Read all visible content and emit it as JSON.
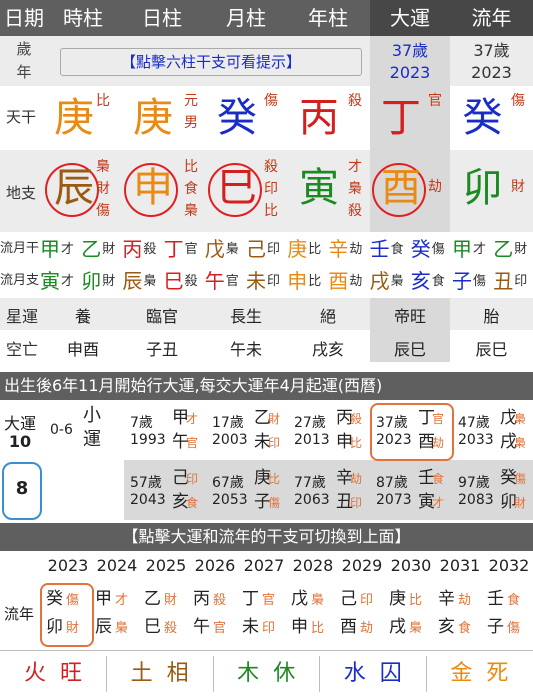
{
  "header": {
    "date": "日期",
    "hour": "時柱",
    "day": "日柱",
    "month": "月柱",
    "year": "年柱",
    "dayun": "大運",
    "liunian": "流年"
  },
  "age_row": {
    "label1": "歲",
    "label2": "年",
    "hint": "【點擊六柱干支可看提示】",
    "dayun_age": "37歲",
    "dayun_year": "2023",
    "ln_age": "37歲",
    "ln_year": "2023"
  },
  "tiangan": {
    "label": "天干",
    "cells": [
      {
        "char": "庚",
        "color": "#e98a12",
        "god": "比",
        "god2": ""
      },
      {
        "char": "庚",
        "color": "#e98a12",
        "god": "元",
        "god2": "男"
      },
      {
        "char": "癸",
        "color": "#1a2cc8",
        "god": "傷",
        "god2": ""
      },
      {
        "char": "丙",
        "color": "#d41f1f",
        "god": "殺",
        "god2": ""
      },
      {
        "char": "丁",
        "color": "#d41f1f",
        "god": "官",
        "god2": ""
      },
      {
        "char": "癸",
        "color": "#1a2cc8",
        "god": "傷",
        "god2": ""
      }
    ]
  },
  "dizhi": {
    "label": "地支",
    "cells": [
      {
        "char": "辰",
        "color": "#9a5a12",
        "gods": [
          "梟",
          "財",
          "傷"
        ]
      },
      {
        "char": "申",
        "color": "#e98a12",
        "gods": [
          "比",
          "食",
          "梟"
        ]
      },
      {
        "char": "巳",
        "color": "#d41f1f",
        "gods": [
          "殺",
          "印",
          "比"
        ]
      },
      {
        "char": "寅",
        "color": "#1c8a22",
        "gods": [
          "才",
          "梟",
          "殺"
        ]
      },
      {
        "char": "酉",
        "color": "#e98a12",
        "gods": [
          "劫"
        ]
      },
      {
        "char": "卯",
        "color": "#1c8a22",
        "gods": [
          "財"
        ]
      }
    ]
  },
  "month_gan": {
    "label": "流月干",
    "items": [
      [
        "甲",
        "才",
        "#1c8a22"
      ],
      [
        "乙",
        "財",
        "#1c8a22"
      ],
      [
        "丙",
        "殺",
        "#d41f1f"
      ],
      [
        "丁",
        "官",
        "#d41f1f"
      ],
      [
        "戊",
        "梟",
        "#9a5a12"
      ],
      [
        "己",
        "印",
        "#9a5a12"
      ],
      [
        "庚",
        "比",
        "#e98a12"
      ],
      [
        "辛",
        "劫",
        "#e98a12"
      ],
      [
        "壬",
        "食",
        "#1a2cc8"
      ],
      [
        "癸",
        "傷",
        "#1a2cc8"
      ],
      [
        "甲",
        "才",
        "#1c8a22"
      ],
      [
        "乙",
        "財",
        "#1c8a22"
      ]
    ]
  },
  "month_zhi": {
    "label": "流月支",
    "items": [
      [
        "寅",
        "才",
        "#1c8a22"
      ],
      [
        "卯",
        "財",
        "#1c8a22"
      ],
      [
        "辰",
        "梟",
        "#9a5a12"
      ],
      [
        "巳",
        "殺",
        "#d41f1f"
      ],
      [
        "午",
        "官",
        "#d41f1f"
      ],
      [
        "未",
        "印",
        "#9a5a12"
      ],
      [
        "申",
        "比",
        "#e98a12"
      ],
      [
        "酉",
        "劫",
        "#e98a12"
      ],
      [
        "戌",
        "梟",
        "#9a5a12"
      ],
      [
        "亥",
        "食",
        "#1a2cc8"
      ],
      [
        "子",
        "傷",
        "#1a2cc8"
      ],
      [
        "丑",
        "印",
        "#9a5a12"
      ]
    ]
  },
  "xingyun": {
    "label": "星運",
    "cells": [
      "養",
      "臨官",
      "長生",
      "絕",
      "帝旺",
      "胎"
    ]
  },
  "kongwang": {
    "label": "空亡",
    "cells": [
      "申酉",
      "子丑",
      "午未",
      "戌亥",
      "辰巳",
      "辰巳"
    ]
  },
  "dayun_bar": "出生後6年11月開始行大運,每交大運年4月起運(西曆)",
  "dayun_block": {
    "label": "大運",
    "num": "10",
    "range": "0-6",
    "small1": "小",
    "small2": "運",
    "current": "8",
    "items": [
      {
        "age": "7歲",
        "year": "1993",
        "g": "甲",
        "gc": "#1c8a22",
        "gg": "才",
        "z": "午",
        "zc": "#d41f1f",
        "zg": "官"
      },
      {
        "age": "17歲",
        "year": "2003",
        "g": "乙",
        "gc": "#1c8a22",
        "gg": "財",
        "z": "未",
        "zc": "#9a5a12",
        "zg": "印"
      },
      {
        "age": "27歲",
        "year": "2013",
        "g": "丙",
        "gc": "#d41f1f",
        "gg": "殺",
        "z": "申",
        "zc": "#e98a12",
        "zg": "比"
      },
      {
        "age": "37歲",
        "year": "2023",
        "g": "丁",
        "gc": "#d41f1f",
        "gg": "官",
        "z": "酉",
        "zc": "#e98a12",
        "zg": "劫"
      },
      {
        "age": "47歲",
        "year": "2033",
        "g": "戊",
        "gc": "#9a5a12",
        "gg": "梟",
        "z": "戌",
        "zc": "#9a5a12",
        "zg": "梟"
      },
      {
        "age": "57歲",
        "year": "2043",
        "g": "己",
        "gc": "#9a5a12",
        "gg": "印",
        "z": "亥",
        "zc": "#1a2cc8",
        "zg": "食"
      },
      {
        "age": "67歲",
        "year": "2053",
        "g": "庚",
        "gc": "#e98a12",
        "gg": "比",
        "z": "子",
        "zc": "#1a2cc8",
        "zg": "傷"
      },
      {
        "age": "77歲",
        "year": "2063",
        "g": "辛",
        "gc": "#e98a12",
        "gg": "劫",
        "z": "丑",
        "zc": "#9a5a12",
        "zg": "印"
      },
      {
        "age": "87歲",
        "year": "2073",
        "g": "壬",
        "gc": "#1a2cc8",
        "gg": "食",
        "z": "寅",
        "zc": "#1c8a22",
        "zg": "才"
      },
      {
        "age": "97歲",
        "year": "2083",
        "g": "癸",
        "gc": "#1a2cc8",
        "gg": "傷",
        "z": "卯",
        "zc": "#1c8a22",
        "zg": "財"
      }
    ]
  },
  "switch_bar": "【點擊大運和流年的干支可切換到上面】",
  "liunian_block": {
    "label": "流年",
    "years": [
      "2023",
      "2024",
      "2025",
      "2026",
      "2027",
      "2028",
      "2029",
      "2030",
      "2031",
      "2032"
    ],
    "items": [
      {
        "g": "癸",
        "gc": "#1a2cc8",
        "gg": "傷",
        "z": "卯",
        "zc": "#1c8a22",
        "zg": "財"
      },
      {
        "g": "甲",
        "gc": "#1c8a22",
        "gg": "才",
        "z": "辰",
        "zc": "#9a5a12",
        "zg": "梟"
      },
      {
        "g": "乙",
        "gc": "#1c8a22",
        "gg": "財",
        "z": "巳",
        "zc": "#d41f1f",
        "zg": "殺"
      },
      {
        "g": "丙",
        "gc": "#d41f1f",
        "gg": "殺",
        "z": "午",
        "zc": "#d41f1f",
        "zg": "官"
      },
      {
        "g": "丁",
        "gc": "#d41f1f",
        "gg": "官",
        "z": "未",
        "zc": "#9a5a12",
        "zg": "印"
      },
      {
        "g": "戊",
        "gc": "#9a5a12",
        "gg": "梟",
        "z": "申",
        "zc": "#e98a12",
        "zg": "比"
      },
      {
        "g": "己",
        "gc": "#9a5a12",
        "gg": "印",
        "z": "酉",
        "zc": "#e98a12",
        "zg": "劫"
      },
      {
        "g": "庚",
        "gc": "#e98a12",
        "gg": "比",
        "z": "戌",
        "zc": "#9a5a12",
        "zg": "梟"
      },
      {
        "g": "辛",
        "gc": "#e98a12",
        "gg": "劫",
        "z": "亥",
        "zc": "#1a2cc8",
        "zg": "食"
      },
      {
        "g": "壬",
        "gc": "#1a2cc8",
        "gg": "食",
        "z": "子",
        "zc": "#1a2cc8",
        "zg": "傷"
      }
    ]
  },
  "wuxing": [
    {
      "el": "火",
      "st": "旺",
      "color": "#d41f1f"
    },
    {
      "el": "土",
      "st": "相",
      "color": "#9a5a12"
    },
    {
      "el": "木",
      "st": "休",
      "color": "#1c8a22"
    },
    {
      "el": "水",
      "st": "囚",
      "color": "#1a2cc8"
    },
    {
      "el": "金",
      "st": "死",
      "color": "#e98a12"
    }
  ],
  "colors": {
    "god_red": "#c43a1a",
    "god_orange": "#e2733b",
    "dark_bar": "#5f5f5f"
  }
}
